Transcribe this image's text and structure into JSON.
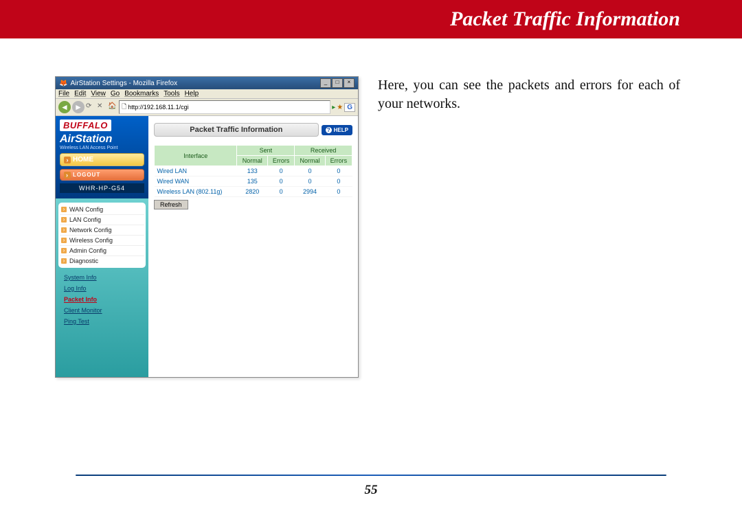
{
  "header": {
    "title": "Packet Traffic Information"
  },
  "description": "Here, you can see the packets and errors for each of your networks.",
  "page_number": "55",
  "browser": {
    "title": "AirStation Settings - Mozilla Firefox",
    "menu": [
      "File",
      "Edit",
      "View",
      "Go",
      "Bookmarks",
      "Tools",
      "Help"
    ],
    "url": "http://192.168.11.1/cgi"
  },
  "sidebar": {
    "brand": "BUFFALO",
    "product": "AirStation",
    "product_sub": "Wireless LAN Access Point",
    "home_label": "HOME",
    "logout_label": "LOGOUT",
    "model": "WHR-HP-G54",
    "nav": [
      "WAN Config",
      "LAN Config",
      "Network Config",
      "Wireless Config",
      "Admin Config",
      "Diagnostic"
    ],
    "subnav": [
      {
        "label": "System Info",
        "active": false
      },
      {
        "label": "Log Info",
        "active": false
      },
      {
        "label": "Packet Info",
        "active": true
      },
      {
        "label": "Client Monitor",
        "active": false
      },
      {
        "label": "Ping Test",
        "active": false
      }
    ]
  },
  "panel": {
    "title": "Packet Traffic Information",
    "help_label": "HELP",
    "table": {
      "col_interface": "Interface",
      "col_sent": "Sent",
      "col_received": "Received",
      "sub_normal": "Normal",
      "sub_errors": "Errors",
      "rows": [
        {
          "iface": "Wired LAN",
          "sn": "133",
          "se": "0",
          "rn": "0",
          "re": "0"
        },
        {
          "iface": "Wired WAN",
          "sn": "135",
          "se": "0",
          "rn": "0",
          "re": "0"
        },
        {
          "iface": "Wireless LAN (802.11g)",
          "sn": "2820",
          "se": "0",
          "rn": "2994",
          "re": "0"
        }
      ]
    },
    "refresh_label": "Refresh"
  }
}
